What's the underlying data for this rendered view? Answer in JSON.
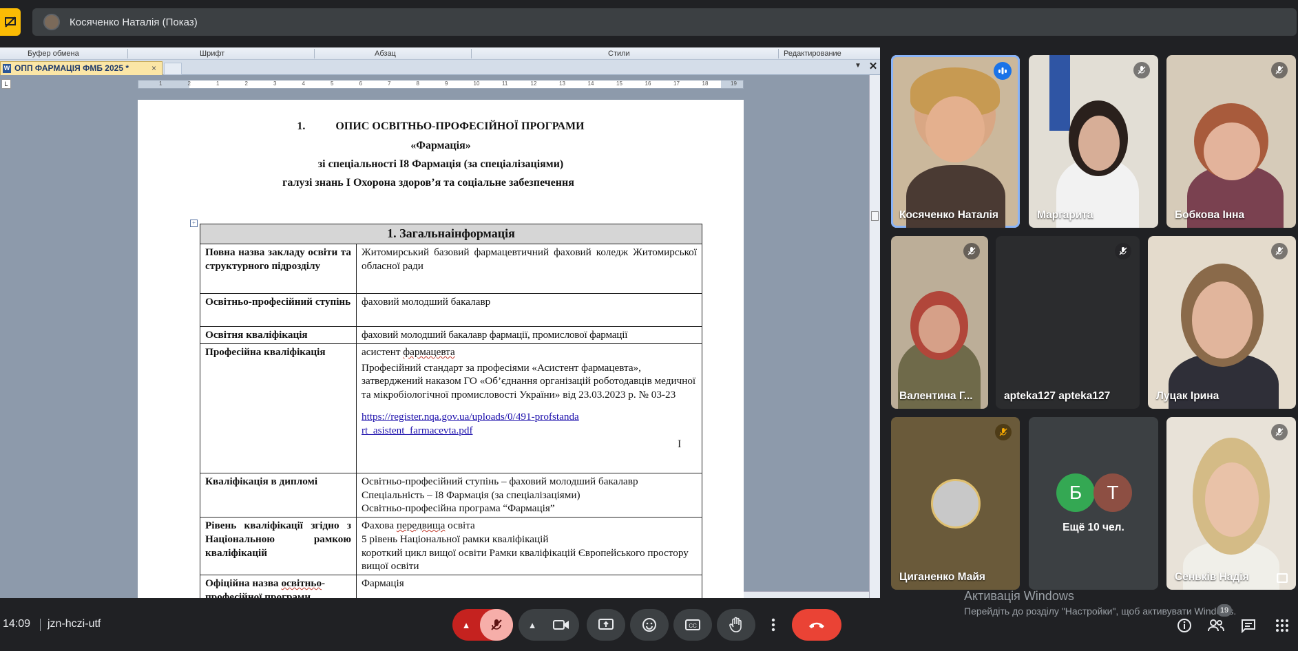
{
  "present_bar": {
    "title": "Косяченко Наталія (Показ)"
  },
  "word": {
    "ribbon": {
      "clipboard": "Буфер обмена",
      "font": "Шрифт",
      "paragraph": "Абзац",
      "styles": "Стили",
      "editing": "Редактирование"
    },
    "tab_title": "ОПП ФАРМАЦІЯ ФМБ 2025 *",
    "tab_close": "×",
    "ruler_ticks": [
      "1",
      "2",
      "1",
      "2",
      "3",
      "4",
      "5",
      "6",
      "7",
      "8",
      "9",
      "10",
      "11",
      "12",
      "13",
      "14",
      "15",
      "16",
      "17",
      "18",
      "19"
    ],
    "doc": {
      "heading_num": "1.",
      "heading": "ОПИС ОСВІТНЬО-ПРОФЕСІЙНОЇ ПРОГРАМИ",
      "program": "«Фармація»",
      "specialty": "зі спеціальності І8 Фармація (за спеціалізаціями)",
      "field": "галузі знань  І Охорона здоров’я та соціальне забезпечення",
      "table_header": "1. Загальнаінформація",
      "rows": [
        {
          "label": "Повна назва закладу освіти та структурного підрозділу",
          "value": "Житомирський базовий фармацевтичний фаховий коледж Житомирської обласної ради"
        },
        {
          "label": "Освітньо-професійний ступінь",
          "value": "фаховий молодший бакалавр"
        },
        {
          "label": "Освітня кваліфікація",
          "value": "фаховий молодший бакалавр фармації, промислової фармації"
        },
        {
          "label": "Професійна кваліфікація",
          "value_line1_a": "асистент ",
          "value_line1_b": "фармацевта",
          "value_p2": "Професійний стандарт за професіями «Асистент фармацевта», затверджений наказом ГО «Об’єднання організацій роботодавців медичної та мікробіологічної промисловості України» від 23.03.2023 р. № 03-23",
          "link": "https://register.nqa.gov.ua/uploads/0/491-profstandart_asistent_farmacevta.pdf"
        },
        {
          "label": "Кваліфікація в дипломі",
          "value_l1": "Освітньо-професійний ступінь – фаховий молодший бакалавр",
          "value_l2": "Спеціальність – І8 Фармація (за спеціалізаціями)",
          "value_l3": "Освітньо-професійна програма “Фармація”"
        },
        {
          "label": "Рівень кваліфікації згідно з Національною рамкою кваліфікацій",
          "value_l1a": "Фахова ",
          "value_l1b": "передвища",
          "value_l1c": " освіта",
          "value_l2": "5 рівень Національної рамки кваліфікацій",
          "value_l3": "короткий цикл вищої освіти Рамки кваліфікацій Європейського простору вищої освіти"
        },
        {
          "label_a": "Офіційна назва ",
          "label_b": "освітньо",
          "label_c": "-професійної програми",
          "value": "Фармація"
        }
      ]
    }
  },
  "participants": [
    {
      "name": "Косяченко Наталія",
      "state": "speaking"
    },
    {
      "name": "Маргарита",
      "state": "muted"
    },
    {
      "name": "Бобкова Інна",
      "state": "muted"
    },
    {
      "name": "Валентина Г...",
      "state": "muted"
    },
    {
      "name": "apteka127 apteka127",
      "state": "muted"
    },
    {
      "name": "Луцак Ірина",
      "state": "muted"
    },
    {
      "name": "Циганенко Майя",
      "state": "muted"
    },
    {
      "name": "Сеньків Надія",
      "state": "muted"
    }
  ],
  "others": {
    "avatar1": "Б",
    "avatar2": "Т",
    "label": "Ещё 10 чел.",
    "colors": [
      "#34a853",
      "#8d4f43"
    ]
  },
  "watermark": {
    "title": "Активація Windows",
    "subtitle": "Перейдіть до розділу \"Настройки\", щоб активувати Windows."
  },
  "bottom": {
    "time": "14:09",
    "meeting_code": "jzn-hczi-utf",
    "people_count": "19"
  },
  "colors": {
    "accent": "#8ab4f8",
    "mute_red": "#c5221f",
    "hangup": "#ea4335",
    "present": "#fbbc04"
  }
}
